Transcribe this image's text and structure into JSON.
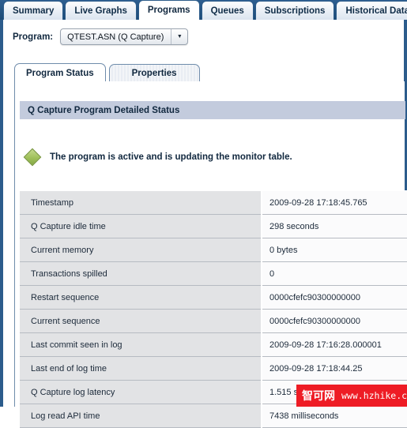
{
  "top_tabs": [
    {
      "label": "Summary",
      "active": false
    },
    {
      "label": "Live Graphs",
      "active": false
    },
    {
      "label": "Programs",
      "active": true
    },
    {
      "label": "Queues",
      "active": false
    },
    {
      "label": "Subscriptions",
      "active": false
    },
    {
      "label": "Historical Data",
      "active": false
    }
  ],
  "program_selector": {
    "label": "Program:",
    "value": "QTEST.ASN (Q Capture)",
    "arrow_icon": "chevron-down-icon",
    "arrow_glyph": "▼"
  },
  "inner_tabs": [
    {
      "label": "Program Status",
      "active": true
    },
    {
      "label": "Properties",
      "active": false
    }
  ],
  "panel": {
    "header": "Q Capture Program Detailed Status",
    "status": {
      "icon": "green-diamond-status-icon",
      "message": "The program is active and is updating the monitor table."
    },
    "rows": [
      {
        "key": "Timestamp",
        "value": "2009-09-28 17:18:45.765"
      },
      {
        "key": "Q Capture idle time",
        "value": "298 seconds"
      },
      {
        "key": "Current memory",
        "value": "0 bytes"
      },
      {
        "key": "Transactions spilled",
        "value": "0"
      },
      {
        "key": "Restart sequence",
        "value": "0000cfefc90300000000"
      },
      {
        "key": "Current sequence",
        "value": "0000cfefc90300000000"
      },
      {
        "key": "Last commit seen in log",
        "value": "2009-09-28 17:16:28.000001"
      },
      {
        "key": "Last end of log time",
        "value": "2009-09-28 17:18:44.25"
      },
      {
        "key": "Q Capture log latency",
        "value": "1.515 seconds"
      },
      {
        "key": "Log read API time",
        "value": "7438 milliseconds"
      }
    ]
  },
  "watermark": {
    "brand": "智可网",
    "url": "www.hzhike.com",
    "background": "#ee1c25"
  },
  "colors": {
    "tabstrip_blue": "#1f4e79",
    "rail_blue": "#2c5c8c",
    "panel_header": "#c3cbdd",
    "row_key_bg": "#e2e3e5",
    "row_value_bg": "#fbfbfc",
    "status_green": "#9fc05a"
  }
}
